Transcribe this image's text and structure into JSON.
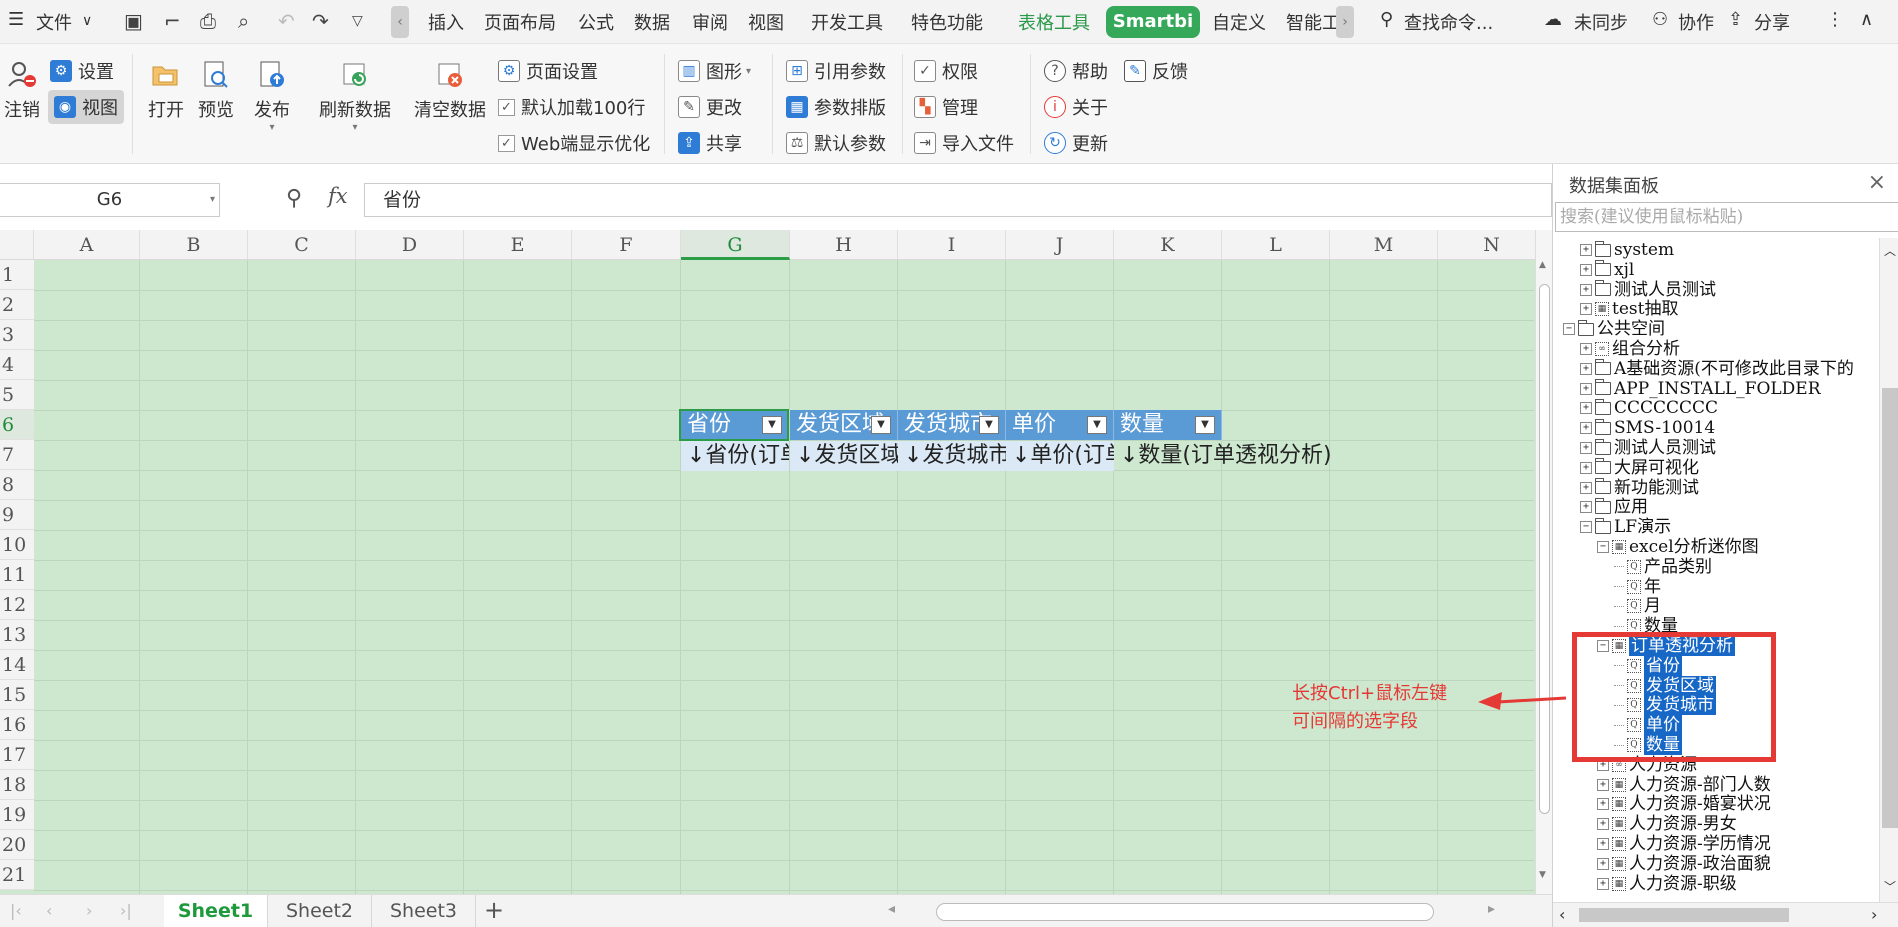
{
  "menubar": {
    "file": "文件",
    "tabs": [
      "插入",
      "页面布局",
      "公式",
      "数据",
      "审阅",
      "视图",
      "开发工具",
      "特色功能"
    ],
    "table_tools": "表格工具",
    "smartbi": "Smartbi",
    "custom": "自定义",
    "smart": "智能工",
    "search": "查找命令...",
    "unsynced": "未同步",
    "collab": "协作",
    "share": "分享"
  },
  "ribbon": {
    "logout": "注销",
    "settings": "设置",
    "view": "视图",
    "open": "打开",
    "preview": "预览",
    "publish": "发布",
    "refresh": "刷新数据",
    "clear": "清空数据",
    "page_setup": "页面设置",
    "default_load": "默认加载100行",
    "web_opt": "Web端显示优化",
    "chart": "图形",
    "change": "更改",
    "share": "共享",
    "ref_param": "引用参数",
    "param_layout": "参数排版",
    "default_param": "默认参数",
    "permission": "权限",
    "manage": "管理",
    "import_file": "导入文件",
    "help": "帮助",
    "feedback": "反馈",
    "about": "关于",
    "update": "更新"
  },
  "formula_bar": {
    "cell_ref": "G6",
    "fx": "fx",
    "value": "省份"
  },
  "grid": {
    "columns": [
      "A",
      "B",
      "C",
      "D",
      "E",
      "F",
      "G",
      "H",
      "I",
      "J",
      "K",
      "L",
      "M",
      "N"
    ],
    "rows": [
      "1",
      "2",
      "3",
      "4",
      "5",
      "6",
      "7",
      "8",
      "9",
      "10",
      "11",
      "12",
      "13",
      "14",
      "15",
      "16",
      "17",
      "18",
      "19",
      "20",
      "21"
    ],
    "header_cells": [
      "省份",
      "发货区域",
      "发货城市",
      "单价",
      "数量"
    ],
    "data_cells": [
      "↓省份(订单透视分析)",
      "↓发货区域(订单透视分析)",
      "↓发货城市(订单透视分析)",
      "↓单价(订单透视分析)",
      "↓数量(订单透视分析)"
    ],
    "overflow_text": "↓数量(订单透视分析)"
  },
  "sheets": [
    "Sheet1",
    "Sheet2",
    "Sheet3"
  ],
  "panel": {
    "title": "数据集面板",
    "search_placeholder": "搜索(建议使用鼠标粘贴)",
    "tree": [
      {
        "label": "system"
      },
      {
        "label": "xjl"
      },
      {
        "label": "测试人员测试"
      },
      {
        "label": "test抽取"
      },
      {
        "label": "公共空间"
      },
      {
        "label": "组合分析"
      },
      {
        "label": "A基础资源(不可修改此目录下的"
      },
      {
        "label": "APP_INSTALL_FOLDER"
      },
      {
        "label": "CCCCCCCC"
      },
      {
        "label": "SMS-10014"
      },
      {
        "label": "测试人员测试"
      },
      {
        "label": "大屏可视化"
      },
      {
        "label": "新功能测试"
      },
      {
        "label": "应用"
      },
      {
        "label": "LF演示"
      },
      {
        "label": "excel分析迷你图"
      },
      {
        "label": "产品类别"
      },
      {
        "label": "年"
      },
      {
        "label": "月"
      },
      {
        "label": "数量"
      },
      {
        "label": "订单透视分析"
      },
      {
        "label": "省份"
      },
      {
        "label": "发货区域"
      },
      {
        "label": "发货城市"
      },
      {
        "label": "单价"
      },
      {
        "label": "数量"
      },
      {
        "label": "人力资源"
      },
      {
        "label": "人力资源-部门人数"
      },
      {
        "label": "人力资源-婚宴状况"
      },
      {
        "label": "人力资源-男女"
      },
      {
        "label": "人力资源-学历情况"
      },
      {
        "label": "人力资源-政治面貌"
      },
      {
        "label": "人力资源-职级"
      }
    ]
  },
  "annotation": {
    "line1": "长按Ctrl+鼠标左键",
    "line2": "可间隔的选字段",
    "color": "#e53935"
  }
}
